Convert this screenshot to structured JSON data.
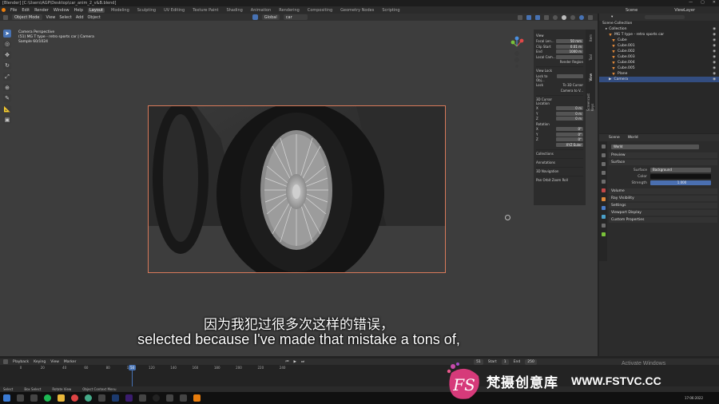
{
  "window": {
    "title": "[Blender] [C:\\Users\\AGP\\Desktop\\car_anim_2_v&B.blend]",
    "controls": [
      "—",
      "▢",
      "✕"
    ]
  },
  "menu": {
    "items": [
      "File",
      "Edit",
      "Render",
      "Window",
      "Help"
    ],
    "workspaces": [
      "Layout",
      "Modeling",
      "Sculpting",
      "UV Editing",
      "Texture Paint",
      "Shading",
      "Animation",
      "Rendering",
      "Compositing",
      "Geometry Nodes",
      "Scripting"
    ],
    "active_workspace": "Layout",
    "scene": "Scene",
    "view_layer": "ViewLayer"
  },
  "viewport_header": {
    "mode": "Object Mode",
    "menus": [
      "View",
      "Select",
      "Add",
      "Object"
    ],
    "orientation": "Global",
    "snap_target": "car",
    "options_label": "Options"
  },
  "viewport_info": {
    "line1": "Camera Perspective",
    "line2": "(51) MG T type - retro sports car | Camera",
    "line3": "Sample 60/1024"
  },
  "npanel": {
    "tabs": [
      "Item",
      "Tool",
      "View",
      "Screencast Keys"
    ],
    "view_header": "View",
    "focal_label": "Focal Len...",
    "focal_value": "50 mm",
    "clip_label": "Clip Start",
    "clip_start": "0.01 m",
    "end_label": "End",
    "clip_end": "1000 m",
    "local_cam_label": "Local Cam...",
    "render_region": "Render Region",
    "view_lock": "View Lock",
    "lock_to_obj": "Lock to Obj...",
    "lock_label": "Lock",
    "to_3d_cursor": "To 3D Cursor",
    "camera_to_view": "Camera to V...",
    "cursor_header": "3D Cursor",
    "location": "Location",
    "loc_x": "0 m",
    "loc_y": "0 m",
    "loc_z": "0 m",
    "rotation": "Rotation",
    "rot_x": "0°",
    "rot_y": "0°",
    "rot_z": "0°",
    "euler": "XYZ Euler",
    "sections": [
      "Collections",
      "Annotations",
      "3D Navigation",
      "Pan Orbit Zoom Roll"
    ]
  },
  "outliner": {
    "search_placeholder": "",
    "items": [
      {
        "label": "Scene Collection",
        "selected": false
      },
      {
        "label": "Collection",
        "selected": false
      },
      {
        "label": "MG T type - retro sports car",
        "selected": false
      },
      {
        "label": "Cube",
        "selected": false
      },
      {
        "label": "Cube.001",
        "selected": false
      },
      {
        "label": "Cube.002",
        "selected": false
      },
      {
        "label": "Cube.003",
        "selected": false
      },
      {
        "label": "Cube.004",
        "selected": false
      },
      {
        "label": "Cube.005",
        "selected": false
      },
      {
        "label": "Plane",
        "selected": false
      },
      {
        "label": "Camera",
        "selected": true
      }
    ]
  },
  "properties": {
    "breadcrumb_scene": "Scene",
    "breadcrumb_world": "World",
    "world_name": "World",
    "sections": [
      "Preview",
      "Surface"
    ],
    "surface_label": "Surface",
    "surface_value": "Background",
    "color_label": "Color",
    "strength_label": "Strength",
    "strength_value": "1.000",
    "more_sections": [
      "Volume",
      "Ray Visibility",
      "Settings",
      "Viewport Display",
      "Custom Properties"
    ]
  },
  "timeline": {
    "menus": [
      "Playback",
      "Keying",
      "View",
      "Marker"
    ],
    "current_frame": "51",
    "start_label": "Start",
    "start": "1",
    "end_label": "End",
    "end": "250",
    "ticks": [
      "0",
      "20",
      "40",
      "60",
      "80",
      "100",
      "120",
      "140",
      "160",
      "180",
      "200",
      "220",
      "240"
    ],
    "frame_indicator": "50"
  },
  "statusbar": {
    "items": [
      "Select",
      "Box Select",
      "Rotate View",
      "Object Context Menu"
    ]
  },
  "taskbar": {
    "time": "17:06:2022"
  },
  "subtitles": {
    "chinese": "因为我犯过很多次这样的错误，",
    "english": "selected because I've made that mistake a tons of,"
  },
  "system": {
    "activate": "Activate Windows"
  },
  "watermark": {
    "logo": "FS",
    "name": "梵摄创意库",
    "url": "WWW.FSTVC.CC"
  }
}
